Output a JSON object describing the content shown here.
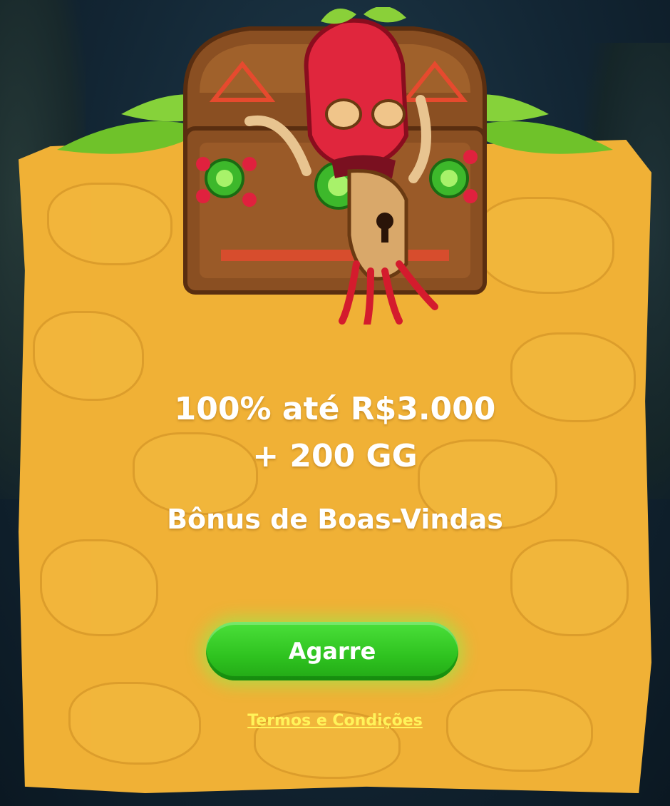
{
  "offer": {
    "headline_line1": "100% até R$3.000",
    "headline_line2": "+ 200 GG",
    "subtitle": "Bônus de Boas-Vindas"
  },
  "cta": {
    "label": "Agarre"
  },
  "terms": {
    "label": "Termos e Condições"
  },
  "colors": {
    "panel": "#f0b136",
    "button": "#2ec21f",
    "terms_link": "#fff35a",
    "background": "#122533"
  },
  "icons": {
    "hero": "tiki-treasure-chest-icon",
    "foliage": "jungle-leaves-icon"
  }
}
